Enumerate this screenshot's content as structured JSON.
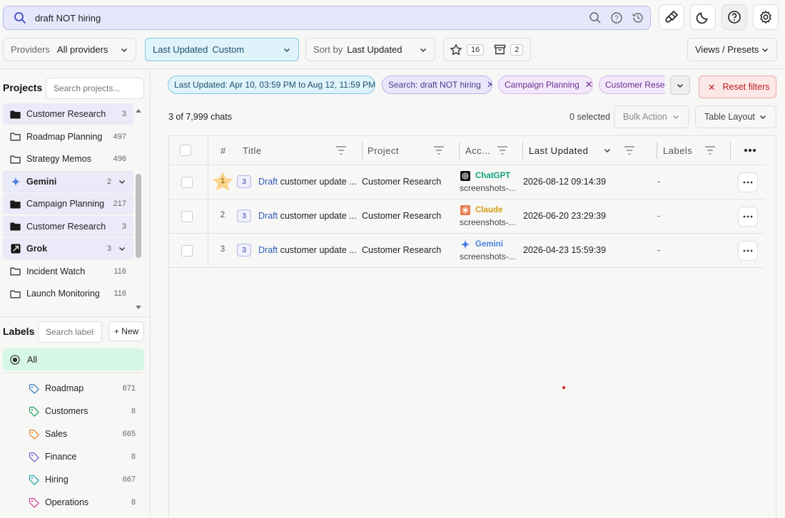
{
  "search": {
    "value": "draft NOT hiring"
  },
  "filters": {
    "providers_label": "Providers",
    "providers_value": "All providers",
    "updated_label": "Last Updated",
    "updated_value": "Custom",
    "sort_label": "Sort by",
    "sort_value": "Last Updated",
    "starred_count": "16",
    "archived_count": "2",
    "views_label": "Views / Presets"
  },
  "sidebar": {
    "projects_title": "Projects",
    "projects_placeholder": "Search projects...",
    "projects": [
      {
        "name": "Customer Research",
        "count": "3",
        "type": "folder-filled",
        "highlight": true
      },
      {
        "name": "Roadmap Planning",
        "count": "497",
        "type": "folder"
      },
      {
        "name": "Strategy Memos",
        "count": "496",
        "type": "folder"
      },
      {
        "name": "Gemini",
        "count": "2",
        "type": "provider"
      },
      {
        "name": "Campaign Planning",
        "count": "217",
        "type": "folder-filled",
        "highlight": true
      },
      {
        "name": "Customer Research",
        "count": "3",
        "type": "folder-filled",
        "highlight": true
      },
      {
        "name": "Grok",
        "count": "3",
        "type": "provider"
      },
      {
        "name": "Incident Watch",
        "count": "116",
        "type": "folder"
      },
      {
        "name": "Launch Monitoring",
        "count": "116",
        "type": "folder"
      }
    ],
    "labels_title": "Labels",
    "labels_placeholder": "Search labels",
    "new_label": "+ New",
    "all_label": "All",
    "labels": [
      {
        "name": "Roadmap",
        "count": "671",
        "color": "#3b82c4"
      },
      {
        "name": "Customers",
        "count": "8",
        "color": "#27a36b"
      },
      {
        "name": "Sales",
        "count": "665",
        "color": "#e08a2c"
      },
      {
        "name": "Finance",
        "count": "8",
        "color": "#7b5cd6"
      },
      {
        "name": "Hiring",
        "count": "667",
        "color": "#1fa5a5"
      },
      {
        "name": "Operations",
        "count": "8",
        "color": "#d6489a"
      }
    ]
  },
  "chips": [
    "Last Updated: Apr 10, 03:59 PM to Aug 12, 11:59 PM",
    "Search: draft NOT hiring",
    "Campaign Planning",
    "Customer Research"
  ],
  "reset_label": "Reset filters",
  "summary": "3 of 7,999 chats",
  "selected": "0 selected",
  "bulk_action": "Bulk Action",
  "table_layout": "Table Layout",
  "table": {
    "headers": {
      "num": "#",
      "title": "Title",
      "project": "Project",
      "account": "Acc...",
      "updated": "Last Updated",
      "labels": "Labels"
    },
    "rows": [
      {
        "num": "1",
        "msgs": "3",
        "title_hl": "Draft",
        "title_rest": " customer update ...",
        "project": "Customer Research",
        "provider": "ChatGPT",
        "account": "screenshots-...",
        "updated": "2026-08-12 09:14:39",
        "labels": "-",
        "starred": true
      },
      {
        "num": "2",
        "msgs": "3",
        "title_hl": "Draft",
        "title_rest": " customer update ...",
        "project": "Customer Research",
        "provider": "Claude",
        "account": "screenshots-...",
        "updated": "2026-06-20 23:29:39",
        "labels": "-",
        "starred": false
      },
      {
        "num": "3",
        "msgs": "3",
        "title_hl": "Draft",
        "title_rest": " customer update ...",
        "project": "Customer Research",
        "provider": "Gemini",
        "account": "screenshots-...",
        "updated": "2026-04-23 15:59:39",
        "labels": "-",
        "starred": false
      }
    ]
  },
  "colors": {
    "chatgpt": "#10a37f",
    "claude": "#d4a017",
    "gemini": "#4a7fe0"
  }
}
